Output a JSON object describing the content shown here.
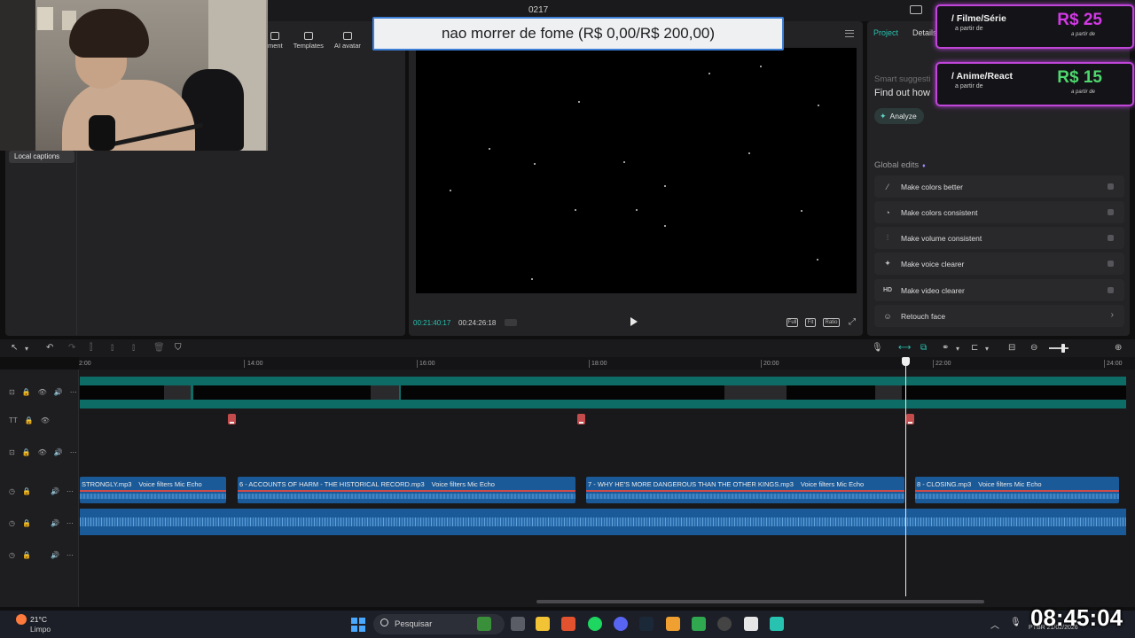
{
  "window": {
    "project_title": "0217"
  },
  "overlay": {
    "goal_text": "nao morrer de fome (R$ 0,00/R$ 200,00)",
    "promos": [
      {
        "title": "/ Filme/Série",
        "subtitle": "a partir de",
        "price": "R$ 25",
        "price_note": "a partir de",
        "price_color": "#d339e6"
      },
      {
        "title": "/ Anime/React",
        "subtitle": "a partir de",
        "price": "R$ 15",
        "price_note": "a partir de",
        "price_color": "#4ed86d"
      }
    ],
    "clock": "08:45:04"
  },
  "left_panel": {
    "toolbar": [
      {
        "label": "ment",
        "icon": "adjustment-icon"
      },
      {
        "label": "Templates",
        "icon": "templates-icon"
      },
      {
        "label": "AI avatar",
        "icon": "ai-avatar-icon"
      }
    ],
    "category": "Local captions"
  },
  "player": {
    "current_time": "00:21:40:17",
    "total_time": "00:24:26:18",
    "controls": [
      "Full",
      "Fit",
      "Ratio",
      "Fullscreen"
    ]
  },
  "right_panel": {
    "tabs": [
      "Project",
      "Details"
    ],
    "smart_label": "Smart suggesti",
    "find_label": "Find out how",
    "analyze_label": "Analyze",
    "global_edits_label": "Global edits",
    "edits": [
      {
        "label": "Make colors better",
        "icon": "magic-wand-icon",
        "glyph": "⁄"
      },
      {
        "label": "Make colors consistent",
        "icon": "color-sync-icon",
        "glyph": "◔"
      },
      {
        "label": "Make volume consistent",
        "icon": "volume-sliders-icon",
        "glyph": "⫶"
      },
      {
        "label": "Make voice clearer",
        "icon": "voice-sparkle-icon",
        "glyph": "✦"
      },
      {
        "label": "Make video clearer",
        "icon": "hd-icon",
        "glyph": "HD"
      },
      {
        "label": "Retouch face",
        "icon": "face-icon",
        "glyph": "☺"
      }
    ]
  },
  "timeline": {
    "ruler_labels": [
      "2:00",
      "14:00",
      "16:00",
      "18:00",
      "20:00",
      "22:00",
      "24:00"
    ],
    "audio_clips": [
      {
        "name": "STRONGLY.mp3",
        "effect": "Voice filters Mic Echo"
      },
      {
        "name": "6 - ACCOUNTS OF HARM - THE HISTORICAL RECORD.mp3",
        "effect": "Voice filters Mic Echo"
      },
      {
        "name": "7 - WHY HE'S MORE DANGEROUS THAN THE OTHER KINGS.mp3",
        "effect": "Voice filters Mic Echo"
      },
      {
        "name": "8 - CLOSING.mp3",
        "effect": "Voice filters Mic Echo"
      }
    ],
    "track_controls": [
      "⊡",
      "🔒",
      "👁",
      "🔊",
      "⋯"
    ]
  },
  "taskbar": {
    "weather_temp": "21°C",
    "weather_cond": "Limpo",
    "search_placeholder": "Pesquisar",
    "tray_date": "PTBR 21/02/2026"
  }
}
